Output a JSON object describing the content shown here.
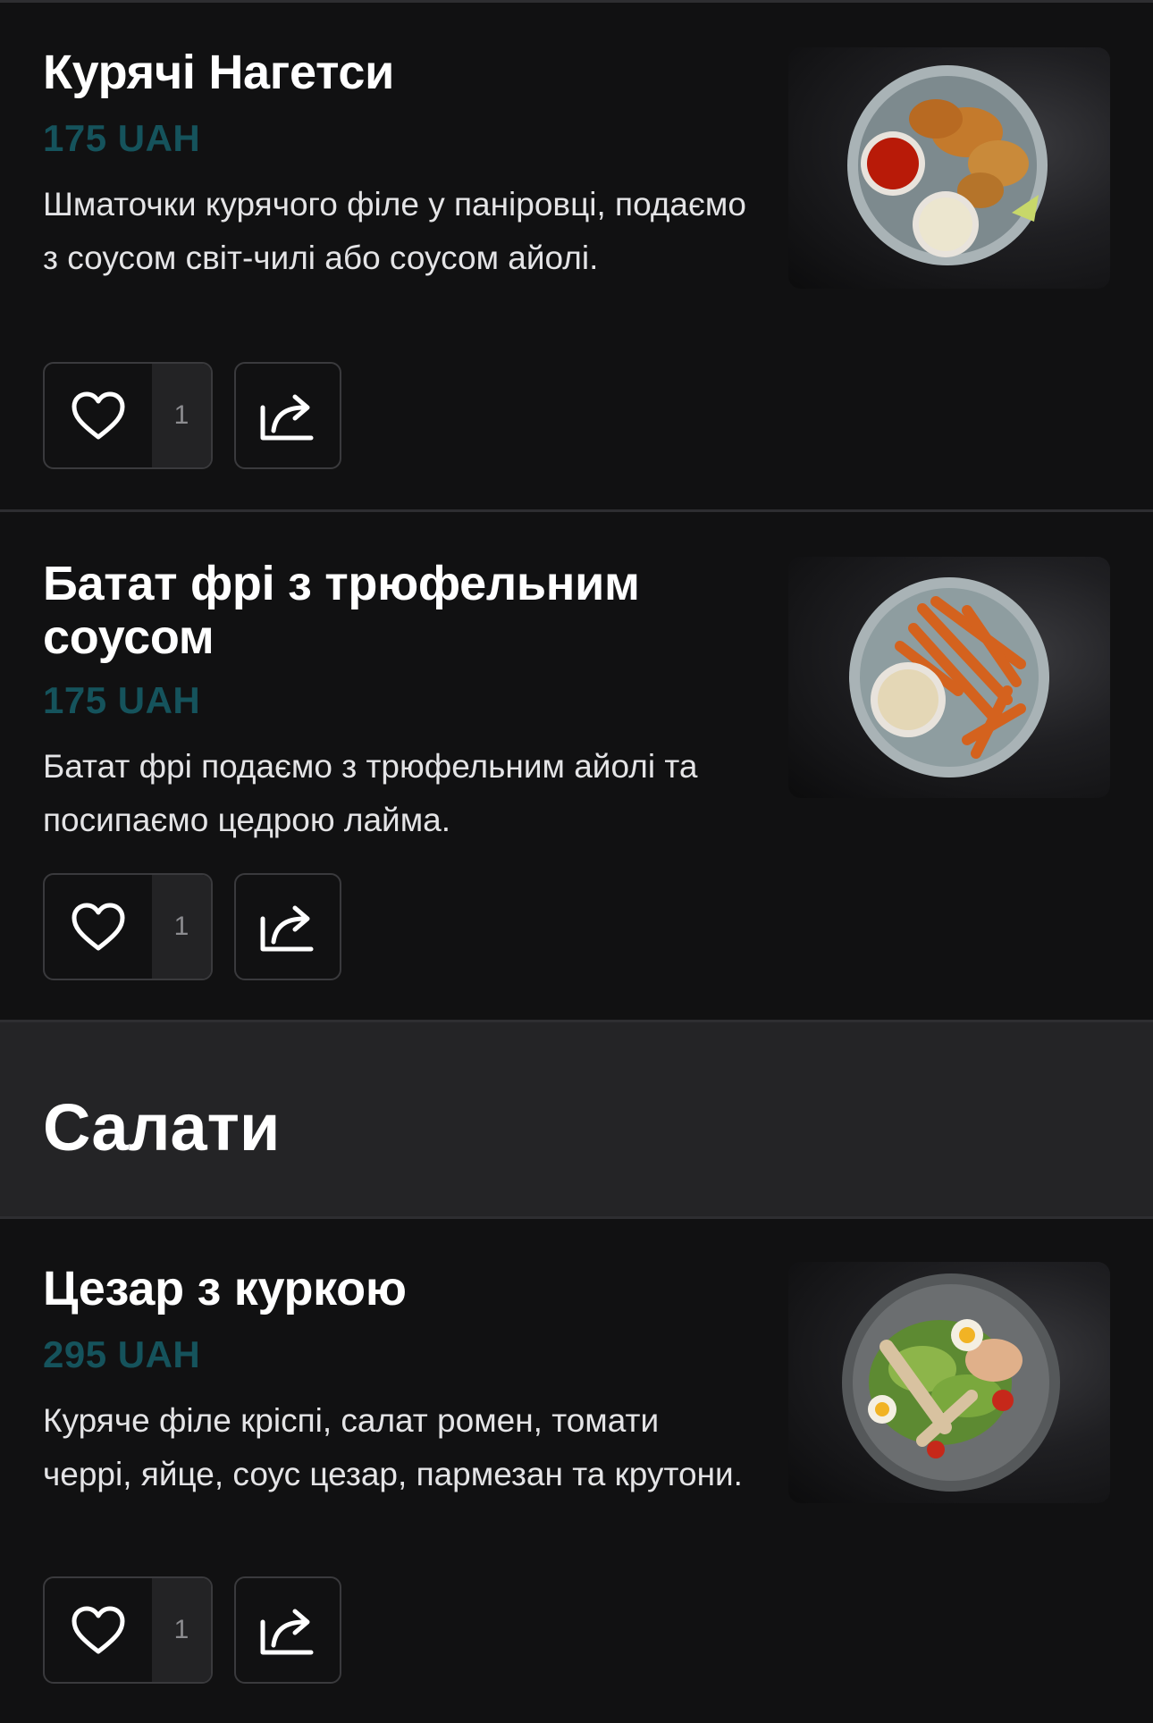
{
  "menu_items": [
    {
      "name": "Курячі Нагетси",
      "price": "175 UAH",
      "description": "Шматочки курячого філе у паніровці, подаємо з соусом світ-чилі або соусом айолі.",
      "likes": "1"
    },
    {
      "name": "Батат фрі з трюфельним соусом",
      "price": "175 UAH",
      "description": "Батат фрі подаємо з трюфельним айолі та посипаємо цедрою лайма.",
      "likes": "1"
    },
    {
      "name": "Цезар з куркою",
      "price": "295 UAH",
      "description": "Куряче філе кріспі, салат ромен, томати черрі, яйце, соус цезар, пармезан та крутони.",
      "likes": "1"
    }
  ],
  "section": {
    "title": "Салати"
  },
  "icons": {
    "like": "heart-icon",
    "share": "share-icon"
  },
  "colors": {
    "background": "#111112",
    "section_background": "#242426",
    "price": "#15535c",
    "divider": "#2e2e31"
  }
}
